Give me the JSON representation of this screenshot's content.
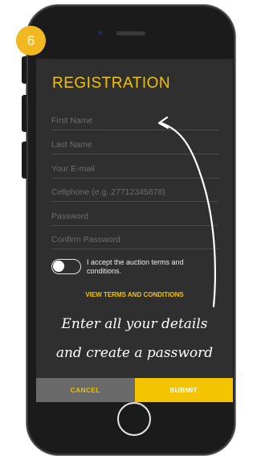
{
  "step_badge": "6",
  "screen": {
    "title": "REGISTRATION",
    "fields": [
      {
        "placeholder": "First Name"
      },
      {
        "placeholder": "Last Name"
      },
      {
        "placeholder": "Your E-mail"
      },
      {
        "placeholder": "Cellphone (e.g. 27712345678)"
      },
      {
        "placeholder": "Password"
      },
      {
        "placeholder": "Confirm Password"
      }
    ],
    "terms_label": "I accept the auction terms and conditions.",
    "terms_toggle_on": false,
    "view_terms": "VIEW TERMS AND CONDITIONS",
    "cancel": "CANCEL",
    "submit": "SUBMIT"
  },
  "annotation": {
    "line1": "Enter all your details",
    "line2": "and create a password"
  },
  "colors": {
    "accent": "#f2c200",
    "badge": "#f2b81f",
    "screen_bg": "#2f2f2f",
    "cancel_bg": "#6a6a6a",
    "submit_bg": "#f5c400"
  }
}
